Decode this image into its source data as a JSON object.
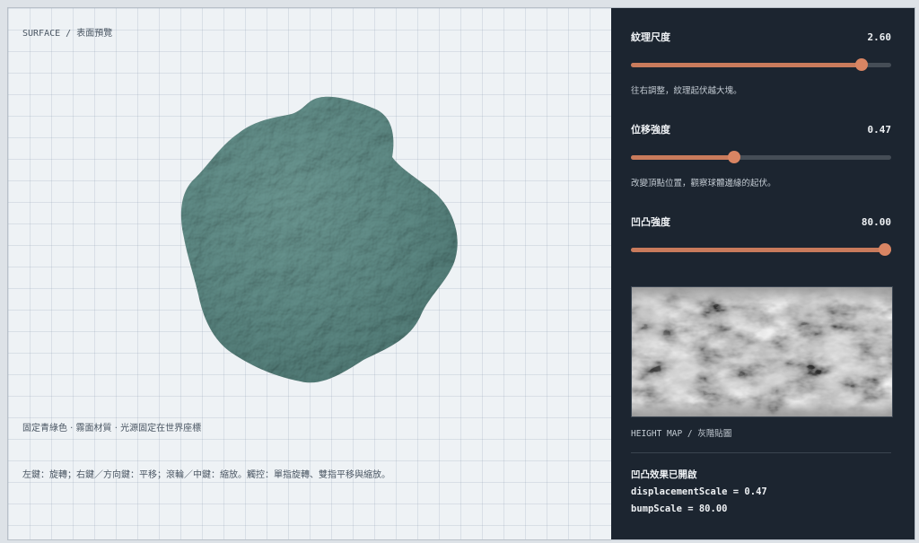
{
  "viewport": {
    "title": "SURFACE / 表面預覽",
    "caption": "固定青綠色 · 霧面材質 · 光源固定在世界座標",
    "help": "左鍵：旋轉；右鍵／方向鍵：平移；滾輪／中鍵：縮放。觸控：單指旋轉、雙指平移與縮放。",
    "rock_color": "#5f8b86"
  },
  "controls": [
    {
      "label": "紋理尺度",
      "value": "2.60",
      "fraction": 0.885,
      "hint": "往右調整，紋理起伏越大塊。"
    },
    {
      "label": "位移強度",
      "value": "0.47",
      "fraction": 0.395,
      "hint": "改變頂點位置，觀察球體邊緣的起伏。"
    },
    {
      "label": "凹凸強度",
      "value": "80.00",
      "fraction": 1.0,
      "hint": ""
    }
  ],
  "heightmap": {
    "caption": "HEIGHT MAP / 灰階貼圖"
  },
  "status": {
    "title": "凹凸效果已開啟",
    "displacement_line": "displacementScale = 0.47",
    "bump_line": "bumpScale = 80.00"
  },
  "colors": {
    "accent": "#d98563",
    "panel_bg": "#1c2530",
    "viewport_bg": "#eef2f5"
  }
}
